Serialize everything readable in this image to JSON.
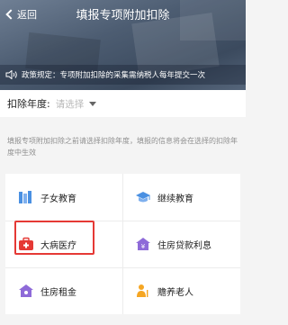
{
  "header": {
    "back_label": "返回",
    "title": "填报专项附加扣除"
  },
  "notice": {
    "icon": "speaker-icon",
    "text": "政策规定：专项附加扣除的采集需纳税人每年提交一次"
  },
  "year_selector": {
    "label": "扣除年度:",
    "placeholder": "请选择",
    "icon": "dropdown-triangle-icon"
  },
  "hint": "填报专项附加扣除之前请选择扣除年度，填报的信息将会在选择的扣除年度中生效",
  "items": [
    {
      "label": "子女教育",
      "icon": "books-icon",
      "color": "#4a90e2"
    },
    {
      "label": "继续教育",
      "icon": "graduation-cap-icon",
      "color": "#4a90e2"
    },
    {
      "label": "大病医疗",
      "icon": "medical-kit-icon",
      "color": "#e53935",
      "highlighted": true
    },
    {
      "label": "住房贷款利息",
      "icon": "house-loan-icon",
      "color": "#8e6ad8"
    },
    {
      "label": "住房租金",
      "icon": "house-rent-icon",
      "color": "#8e6ad8"
    },
    {
      "label": "赡养老人",
      "icon": "elderly-icon",
      "color": "#f5a623"
    }
  ],
  "colors": {
    "highlight": "#e53935",
    "placeholder": "#b8b8b8",
    "hint_text": "#8f8f8f"
  }
}
